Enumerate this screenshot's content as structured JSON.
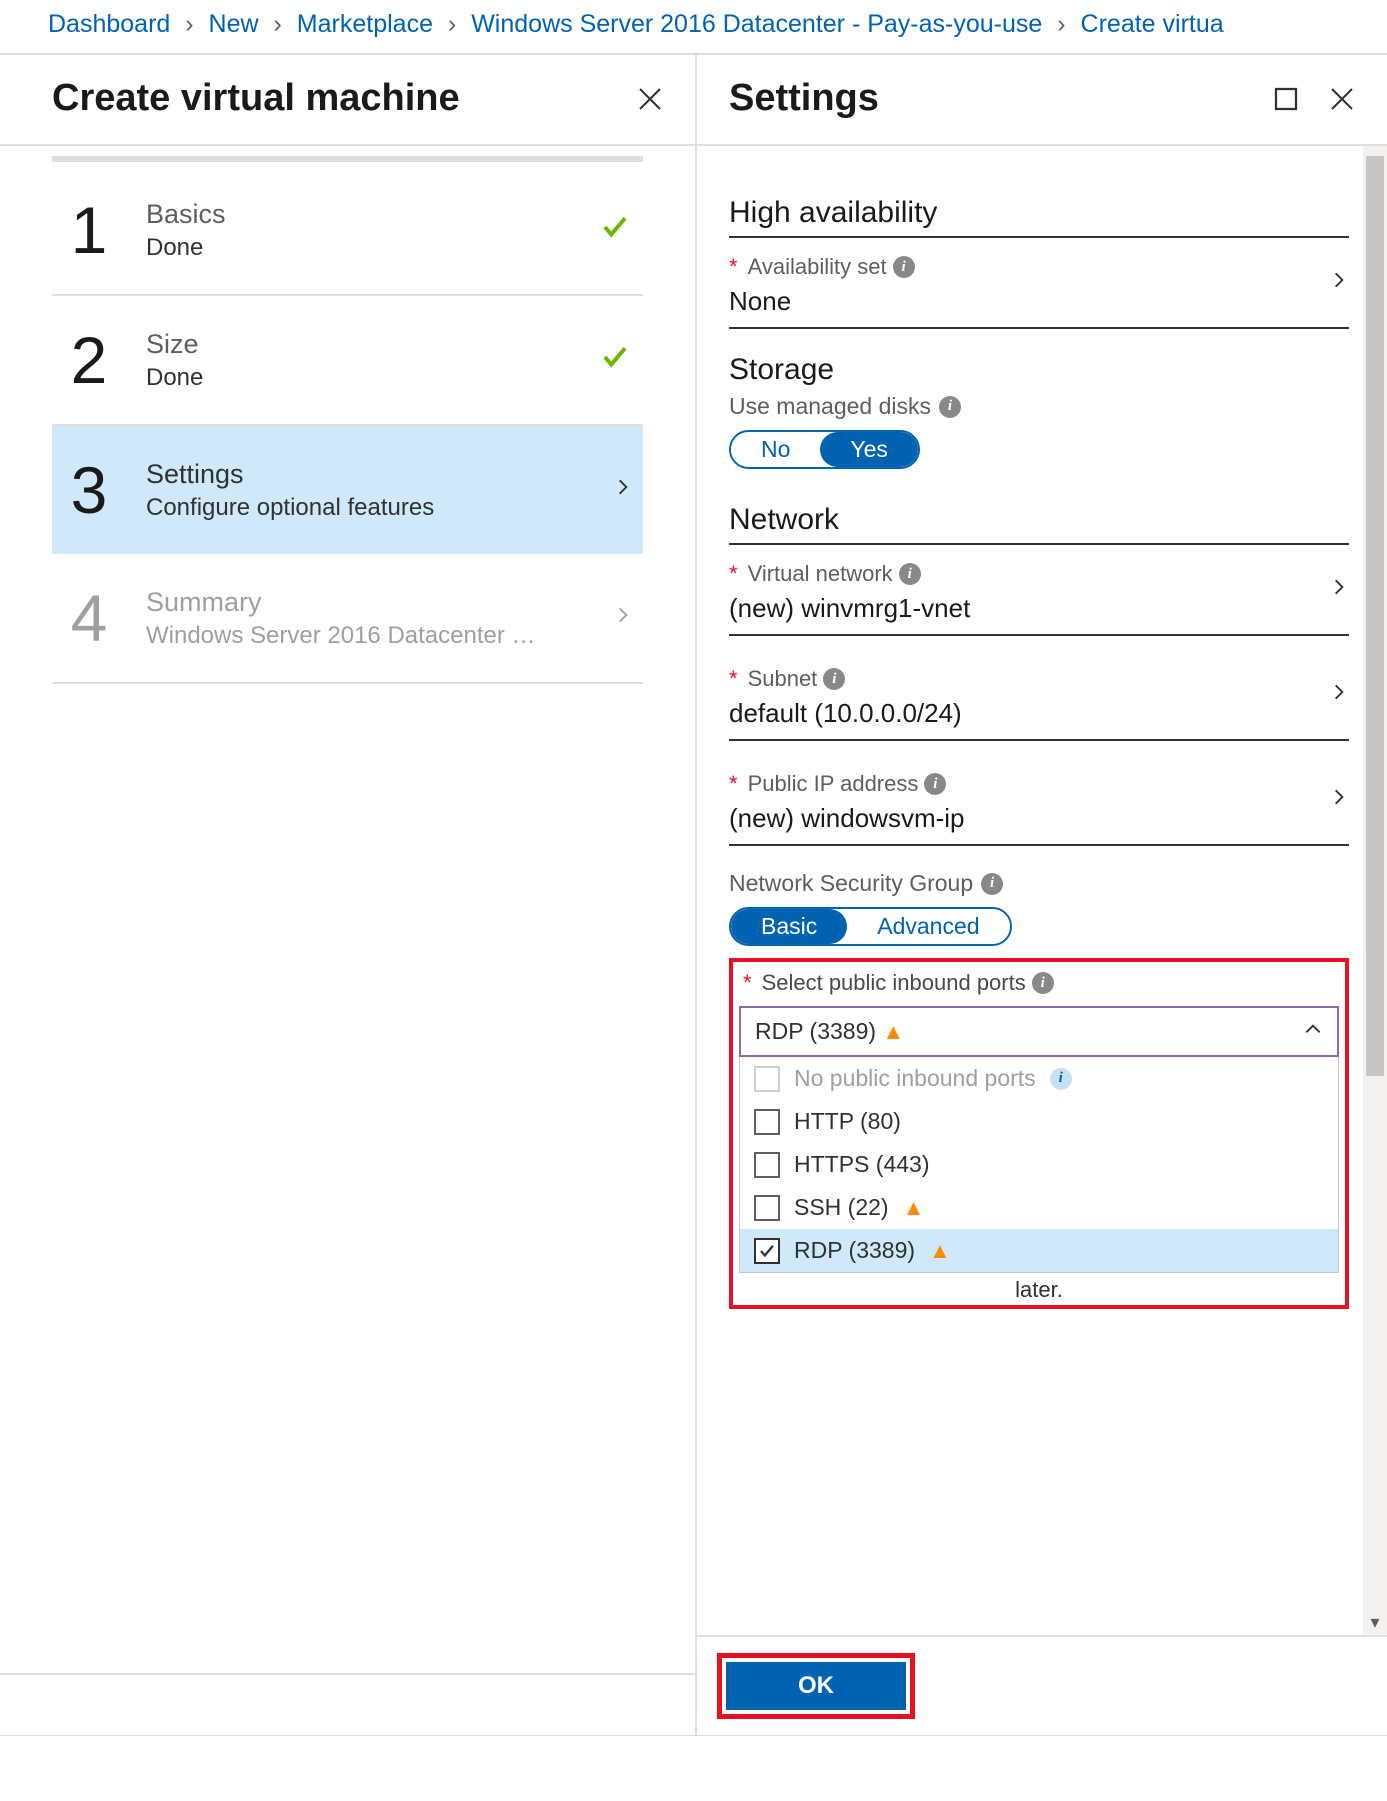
{
  "breadcrumb": {
    "items": [
      "Dashboard",
      "New",
      "Marketplace",
      "Windows Server 2016 Datacenter - Pay-as-you-use",
      "Create virtua"
    ]
  },
  "left": {
    "title": "Create virtual machine",
    "steps": [
      {
        "num": "1",
        "title": "Basics",
        "sub": "Done",
        "status": "done"
      },
      {
        "num": "2",
        "title": "Size",
        "sub": "Done",
        "status": "done"
      },
      {
        "num": "3",
        "title": "Settings",
        "sub": "Configure optional features",
        "status": "active"
      },
      {
        "num": "4",
        "title": "Summary",
        "sub": "Windows Server 2016 Datacenter …",
        "status": "disabled"
      }
    ]
  },
  "right": {
    "title": "Settings",
    "sections": {
      "ha": {
        "heading": "High availability",
        "avail_label": "Availability set",
        "avail_value": "None"
      },
      "storage": {
        "heading": "Storage",
        "managed_label": "Use managed disks",
        "no": "No",
        "yes": "Yes"
      },
      "network": {
        "heading": "Network",
        "vnet_label": "Virtual network",
        "vnet_value": "(new) winvmrg1-vnet",
        "subnet_label": "Subnet",
        "subnet_value": "default (10.0.0.0/24)",
        "pip_label": "Public IP address",
        "pip_value": "(new) windowsvm-ip",
        "nsg_label": "Network Security Group",
        "nsg_basic": "Basic",
        "nsg_advanced": "Advanced",
        "ports_label": "Select public inbound ports",
        "ports_selected": "RDP (3389)",
        "ports_options": [
          {
            "label": "No public inbound ports",
            "warn": false,
            "info": true,
            "disabled": true,
            "checked": false
          },
          {
            "label": "HTTP (80)",
            "warn": false,
            "info": false,
            "disabled": false,
            "checked": false
          },
          {
            "label": "HTTPS (443)",
            "warn": false,
            "info": false,
            "disabled": false,
            "checked": false
          },
          {
            "label": "SSH (22)",
            "warn": true,
            "info": false,
            "disabled": false,
            "checked": false
          },
          {
            "label": "RDP (3389)",
            "warn": true,
            "info": false,
            "disabled": false,
            "checked": true
          }
        ],
        "later": "later."
      }
    },
    "ok": "OK"
  }
}
